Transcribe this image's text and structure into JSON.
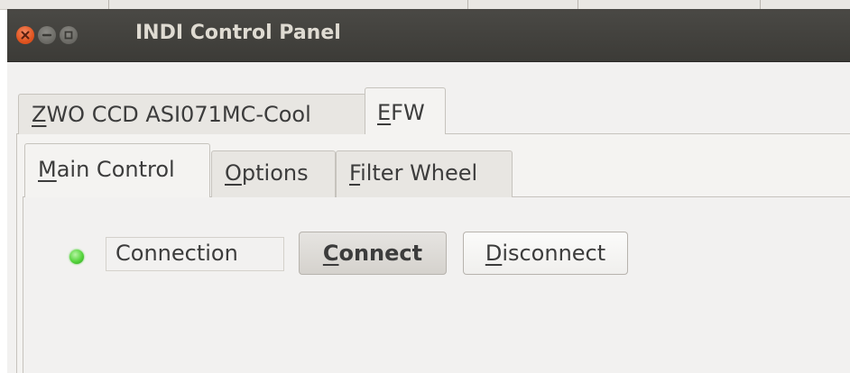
{
  "window": {
    "title": "INDI Control Panel",
    "controls": {
      "close_icon": "close-icon",
      "minimize_icon": "minimize-icon",
      "maximize_icon": "maximize-icon"
    }
  },
  "device_tabs": [
    {
      "prefix": "",
      "mnemonic": "Z",
      "rest": "WO CCD ASI071MC-Cool",
      "active": false
    },
    {
      "prefix": "",
      "mnemonic": "E",
      "rest": "FW",
      "active": true
    }
  ],
  "group_tabs": [
    {
      "prefix": "",
      "mnemonic": "M",
      "rest": "ain Control",
      "active": true
    },
    {
      "prefix": "",
      "mnemonic": "O",
      "rest": "ptions",
      "active": false
    },
    {
      "prefix": "",
      "mnemonic": "F",
      "rest": "ilter Wheel",
      "active": false
    }
  ],
  "connection": {
    "status": "ok",
    "status_color": "#4ccf35",
    "label": "Connection",
    "connect": {
      "mnemonic": "C",
      "rest": "onnect"
    },
    "disconnect": {
      "mnemonic": "D",
      "rest": "isconnect"
    }
  },
  "colors": {
    "titlebar": "#3c3b37",
    "title_text": "#dfdbd2",
    "close_button": "#e0541f",
    "window_bg": "#f2f1f0"
  }
}
